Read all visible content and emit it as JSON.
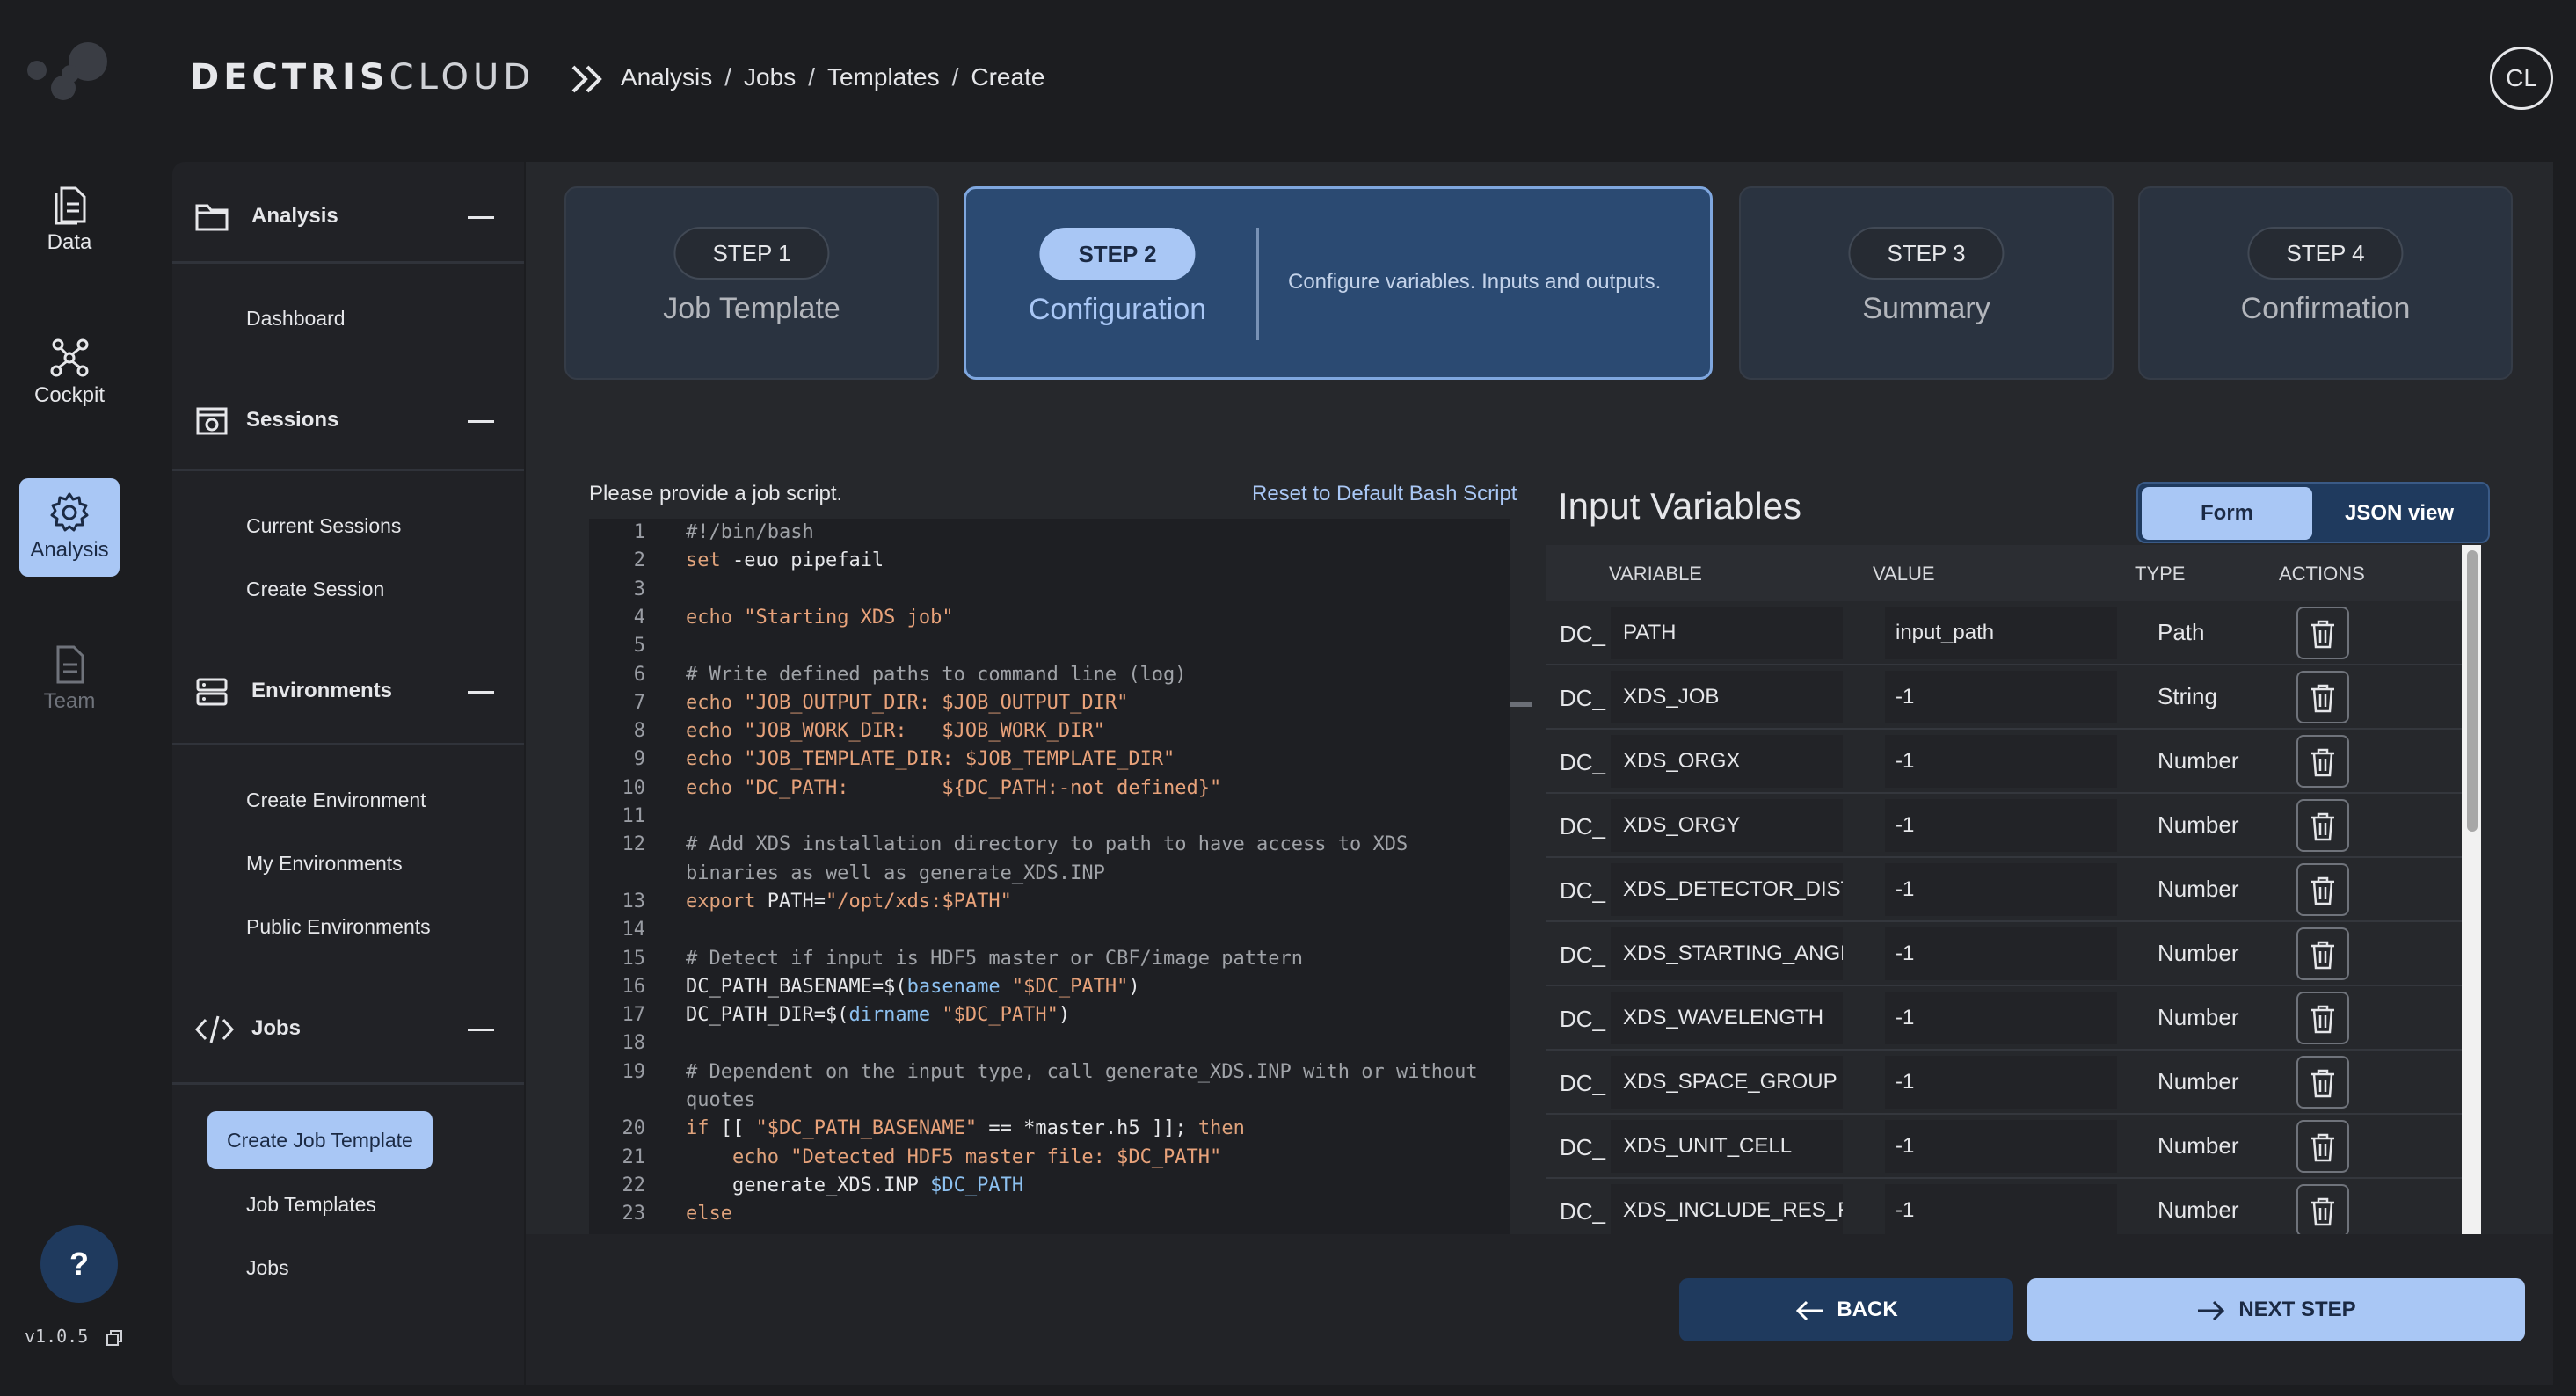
{
  "header": {
    "brand_bold": "DECTRIS",
    "brand_light": "CLOUD",
    "breadcrumb": [
      "Analysis",
      "Jobs",
      "Templates",
      "Create"
    ],
    "avatar_initials": "CL"
  },
  "rail": {
    "items": [
      {
        "label": "Data",
        "icon": "document-icon",
        "state": "normal"
      },
      {
        "label": "Cockpit",
        "icon": "network-icon",
        "state": "normal"
      },
      {
        "label": "Analysis",
        "icon": "gear-icon",
        "state": "active"
      },
      {
        "label": "Team",
        "icon": "document-icon",
        "state": "disabled"
      }
    ],
    "help_label": "?",
    "version": "v1.0.5"
  },
  "sidenav": {
    "sections": [
      {
        "label": "Analysis",
        "icon": "folder-icon",
        "links": [
          "Dashboard"
        ]
      },
      {
        "label": "Sessions",
        "icon": "session-icon",
        "links": [
          "Current Sessions",
          "Create Session"
        ]
      },
      {
        "label": "Environments",
        "icon": "server-icon",
        "links": [
          "Create Environment",
          "My Environments",
          "Public Environments"
        ]
      },
      {
        "label": "Jobs",
        "icon": "code-icon",
        "links": [
          "Create Job Template",
          "Job Templates",
          "Jobs"
        ],
        "active_link": "Create Job Template"
      }
    ]
  },
  "stepper": {
    "steps": [
      {
        "pill": "STEP 1",
        "title": "Job Template",
        "state": "done"
      },
      {
        "pill": "STEP 2",
        "title": "Configuration",
        "state": "active",
        "description": "Configure variables. Inputs and outputs."
      },
      {
        "pill": "STEP 3",
        "title": "Summary",
        "state": "pending"
      },
      {
        "pill": "STEP 4",
        "title": "Confirmation",
        "state": "pending"
      }
    ]
  },
  "editor": {
    "prompt": "Please provide a job script.",
    "reset_label": "Reset to Default Bash Script",
    "lines": [
      {
        "n": "1",
        "segs": [
          [
            "com",
            "#!/bin/bash"
          ]
        ]
      },
      {
        "n": "2",
        "segs": [
          [
            "kw",
            "set"
          ],
          [
            "plain",
            " -euo pipefail"
          ]
        ]
      },
      {
        "n": "3",
        "segs": []
      },
      {
        "n": "4",
        "segs": [
          [
            "kw",
            "echo"
          ],
          [
            "str",
            " \"Starting XDS job\""
          ]
        ]
      },
      {
        "n": "5",
        "segs": []
      },
      {
        "n": "6",
        "segs": [
          [
            "com",
            "# Write defined paths to command line (log)"
          ]
        ]
      },
      {
        "n": "7",
        "segs": [
          [
            "kw",
            "echo"
          ],
          [
            "str",
            " \"JOB_OUTPUT_DIR: $JOB_OUTPUT_DIR\""
          ]
        ]
      },
      {
        "n": "8",
        "segs": [
          [
            "kw",
            "echo"
          ],
          [
            "str",
            " \"JOB_WORK_DIR:   $JOB_WORK_DIR\""
          ]
        ]
      },
      {
        "n": "9",
        "segs": [
          [
            "kw",
            "echo"
          ],
          [
            "str",
            " \"JOB_TEMPLATE_DIR: $JOB_TEMPLATE_DIR\""
          ]
        ]
      },
      {
        "n": "10",
        "segs": [
          [
            "kw",
            "echo"
          ],
          [
            "str",
            " \"DC_PATH:        ${DC_PATH:-not defined}\""
          ]
        ]
      },
      {
        "n": "11",
        "segs": []
      },
      {
        "n": "12",
        "segs": [
          [
            "com",
            "# Add XDS installation directory to path to have access to XDS"
          ]
        ]
      },
      {
        "n": "",
        "segs": [
          [
            "com",
            "binaries as well as generate_XDS.INP"
          ]
        ]
      },
      {
        "n": "13",
        "segs": [
          [
            "kw",
            "export"
          ],
          [
            "plain",
            " PATH="
          ],
          [
            "str",
            "\"/opt/xds:$PATH\""
          ]
        ]
      },
      {
        "n": "14",
        "segs": []
      },
      {
        "n": "15",
        "segs": [
          [
            "com",
            "# Detect if input is HDF5 master or CBF/image pattern"
          ]
        ]
      },
      {
        "n": "16",
        "segs": [
          [
            "plain",
            "DC_PATH_BASENAME=$("
          ],
          [
            "var",
            "basename"
          ],
          [
            "str",
            " \"$DC_PATH\""
          ],
          [
            "plain",
            ")"
          ]
        ]
      },
      {
        "n": "17",
        "segs": [
          [
            "plain",
            "DC_PATH_DIR=$("
          ],
          [
            "var",
            "dirname"
          ],
          [
            "str",
            " \"$DC_PATH\""
          ],
          [
            "plain",
            ")"
          ]
        ]
      },
      {
        "n": "18",
        "segs": []
      },
      {
        "n": "19",
        "segs": [
          [
            "com",
            "# Dependent on the input type, call generate_XDS.INP with or without"
          ]
        ]
      },
      {
        "n": "",
        "segs": [
          [
            "com",
            "quotes"
          ]
        ]
      },
      {
        "n": "20",
        "segs": [
          [
            "kw",
            "if"
          ],
          [
            "plain",
            " [[ "
          ],
          [
            "str",
            "\"$DC_PATH_BASENAME\""
          ],
          [
            "plain",
            " == *master.h5 ]]; "
          ],
          [
            "kw",
            "then"
          ]
        ]
      },
      {
        "n": "21",
        "segs": [
          [
            "plain",
            "    "
          ],
          [
            "kw",
            "echo"
          ],
          [
            "str",
            " \"Detected HDF5 master file: $DC_PATH\""
          ]
        ]
      },
      {
        "n": "22",
        "segs": [
          [
            "plain",
            "    generate_XDS.INP "
          ],
          [
            "var",
            "$DC_PATH"
          ]
        ]
      },
      {
        "n": "23",
        "segs": [
          [
            "kw",
            "else"
          ]
        ]
      }
    ]
  },
  "variables": {
    "title": "Input Variables",
    "toggle": {
      "form": "Form",
      "json": "JSON view"
    },
    "columns": {
      "variable": "VARIABLE",
      "value": "VALUE",
      "type": "TYPE",
      "actions": "ACTIONS"
    },
    "prefix": "DC_",
    "rows": [
      {
        "name": "PATH",
        "value": "input_path",
        "type": "Path"
      },
      {
        "name": "XDS_JOB",
        "value": "-1",
        "type": "String"
      },
      {
        "name": "XDS_ORGX",
        "value": "-1",
        "type": "Number"
      },
      {
        "name": "XDS_ORGY",
        "value": "-1",
        "type": "Number"
      },
      {
        "name": "XDS_DETECTOR_DISTA",
        "value": "-1",
        "type": "Number"
      },
      {
        "name": "XDS_STARTING_ANGLE",
        "value": "-1",
        "type": "Number"
      },
      {
        "name": "XDS_WAVELENGTH",
        "value": "-1",
        "type": "Number"
      },
      {
        "name": "XDS_SPACE_GROUP",
        "value": "-1",
        "type": "Number"
      },
      {
        "name": "XDS_UNIT_CELL",
        "value": "-1",
        "type": "Number"
      },
      {
        "name": "XDS_INCLUDE_RES_RA",
        "value": "-1",
        "type": "Number"
      }
    ]
  },
  "footer": {
    "back_label": "BACK",
    "next_label": "NEXT STEP"
  },
  "colors": {
    "accent": "#a9c7f5",
    "accent_dark": "#1f3a5e",
    "background": "#1c1d20"
  }
}
